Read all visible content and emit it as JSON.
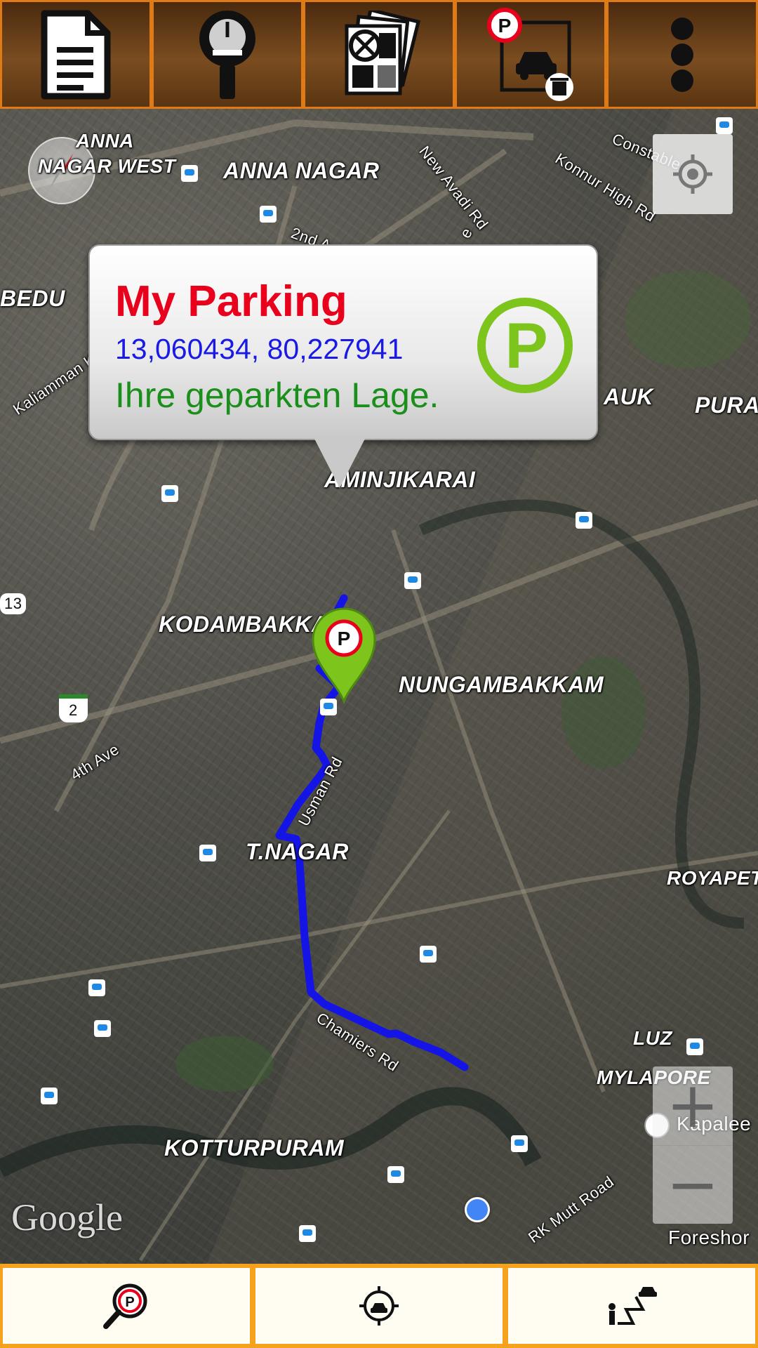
{
  "toolbar": {
    "buttons": [
      {
        "name": "notes",
        "icon": "document-icon"
      },
      {
        "name": "parking-meter",
        "icon": "parking-meter-icon"
      },
      {
        "name": "photos",
        "icon": "photo-stack-icon"
      },
      {
        "name": "delete-parking",
        "icon": "delete-parking-icon"
      },
      {
        "name": "overflow-menu",
        "icon": "more-vertical-icon"
      }
    ]
  },
  "map": {
    "labels": {
      "anna_nagar_west_1": "ANNA",
      "anna_nagar_west_2": "NAGAR WEST",
      "anna_nagar": "ANNA NAGAR",
      "bedu": "BEDU",
      "kaliamman": "Kaliamman Ko",
      "new_avadi": "New Avadi Rd",
      "konnur": "Konnur High Rd",
      "constable": "Constable",
      "second_ave": "2nd A",
      "ave_e": "e",
      "auk": "AUK",
      "pura": "PURA",
      "aminjikarai": "AMINJIKARAI",
      "kodambakkam": "KODAMBAKKAM",
      "nungambakkam": "NUNGAMBAKKAM",
      "route13": "13",
      "route2": "2",
      "fourth_ave": "4th Ave",
      "usman": "Usman Rd",
      "tnagar": "T.NAGAR",
      "royapet": "ROYAPET",
      "chamiers": "Chamiers Rd",
      "luz": "LUZ",
      "mylapore": "MYLAPORE",
      "kapalee": "Kapalee",
      "kotturpuram": "KOTTURPURAM",
      "rk_mutt": "RK Mutt Road",
      "foreshore": "Foreshor"
    },
    "google": "Google",
    "zoom_in": "+",
    "zoom_out": "−"
  },
  "bubble": {
    "title": "My Parking",
    "coordinates": "13,060434, 80,227941",
    "description": "Ihre geparkten Lage.",
    "icon_letter": "P"
  },
  "pin": {
    "letter": "P"
  },
  "colors": {
    "toolbar_bg": "#6b3f17",
    "toolbar_border": "#e07a14",
    "route": "#1414e6",
    "title_red": "#e8001c",
    "coords_blue": "#1a1ae6",
    "desc_green": "#1b8f1b",
    "parking_green": "#7dc41d",
    "bottombar_bg": "#f5a21c"
  },
  "bottombar": {
    "buttons": [
      {
        "name": "find-parking",
        "icon": "search-parking-icon"
      },
      {
        "name": "locate-car",
        "icon": "locate-car-icon"
      },
      {
        "name": "walk-to-car",
        "icon": "walking-route-icon"
      }
    ]
  }
}
